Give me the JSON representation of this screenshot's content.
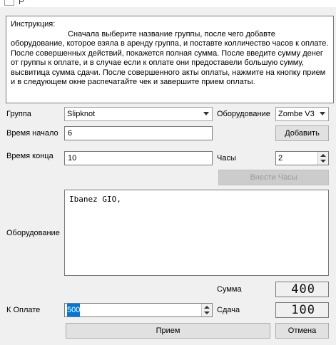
{
  "window": {
    "title": "Р"
  },
  "instructions": {
    "heading": "Инструкция:",
    "text": "Сначала выберите название группы, после чего добавте оборудование, которое взяла в аренду группа, и поставте колличество часов к оплате. После совершенных действий, покажется полная сумма. После введите сумму денег от группы к оплате, и в случае если к оплате они предоставели большую сумму, высвитица сумма сдачи. После совершенного акты оплаты, нажмите на кнопку прием и в следующем окне распечатайте чек и завершите прием оплаты."
  },
  "form": {
    "group_label": "Группа",
    "group_value": "Slipknot",
    "equipment_label": "Оборудование",
    "equipment_value": "Zombe V3",
    "add_button": "Добавить",
    "start_label": "Время начало",
    "start_value": "6",
    "end_label": "Время конца",
    "end_value": "10",
    "hours_label": "Часы",
    "hours_value": "2",
    "apply_hours_button": "Внести Часы",
    "equipment_list_label": "Оборудование",
    "equipment_list_text": "Ibanez GIO,",
    "sum_label": "Сумма",
    "sum_value": "400",
    "pay_label": "К Оплате",
    "pay_value": "500",
    "change_label": "Сдача",
    "change_value": "100",
    "accept_button": "Прием",
    "cancel_button": "Отмена"
  }
}
